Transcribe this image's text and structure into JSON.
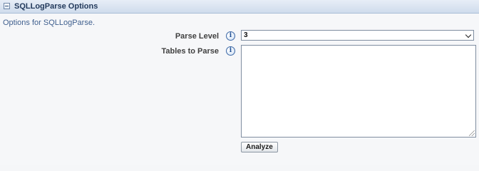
{
  "panel": {
    "title": "SQLLogParse Options",
    "description": "Options for SQLLogParse."
  },
  "fields": {
    "parse_level": {
      "label": "Parse Level",
      "value": "3",
      "info_icon": "info-icon"
    },
    "tables_to_parse": {
      "label": "Tables to Parse",
      "value": "",
      "info_icon": "info-icon"
    }
  },
  "actions": {
    "analyze_label": "Analyze"
  },
  "colors": {
    "header_text": "#233a5c",
    "description_text": "#3f5f8e",
    "label_text": "#404040"
  }
}
